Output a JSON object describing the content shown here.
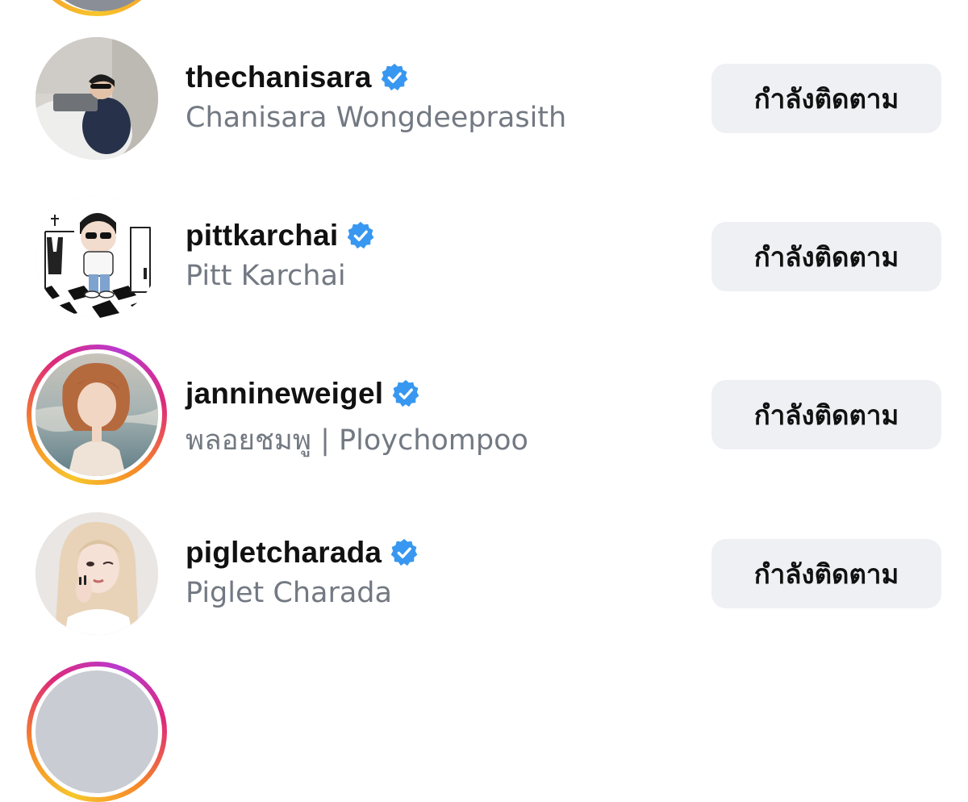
{
  "accounts": [
    {
      "username": "thechanisara",
      "full_name": "Chanisara Wongdeeprasith",
      "verified": true,
      "has_story": false,
      "button_label": "กำลังติดตาม",
      "avatar_icon": "profile-photo"
    },
    {
      "username": "pittkarchai",
      "full_name": "Pitt Karchai",
      "verified": true,
      "has_story": false,
      "button_label": "กำลังติดตาม",
      "avatar_icon": "cartoon-avatar"
    },
    {
      "username": "jannineweigel",
      "full_name": "พลอยชมพู | Ploychompoo",
      "verified": true,
      "has_story": true,
      "button_label": "กำลังติดตาม",
      "avatar_icon": "profile-photo"
    },
    {
      "username": "pigletcharada",
      "full_name": "Piglet Charada",
      "verified": true,
      "has_story": false,
      "button_label": "กำลังติดตาม",
      "avatar_icon": "profile-photo"
    }
  ],
  "colors": {
    "verified_badge": "#3897f0",
    "button_bg": "#eef0f4",
    "username_text": "#111111",
    "fullname_text": "#737982",
    "story_ring_start": "#f7c62c",
    "story_ring_end": "#dd2a7b"
  }
}
